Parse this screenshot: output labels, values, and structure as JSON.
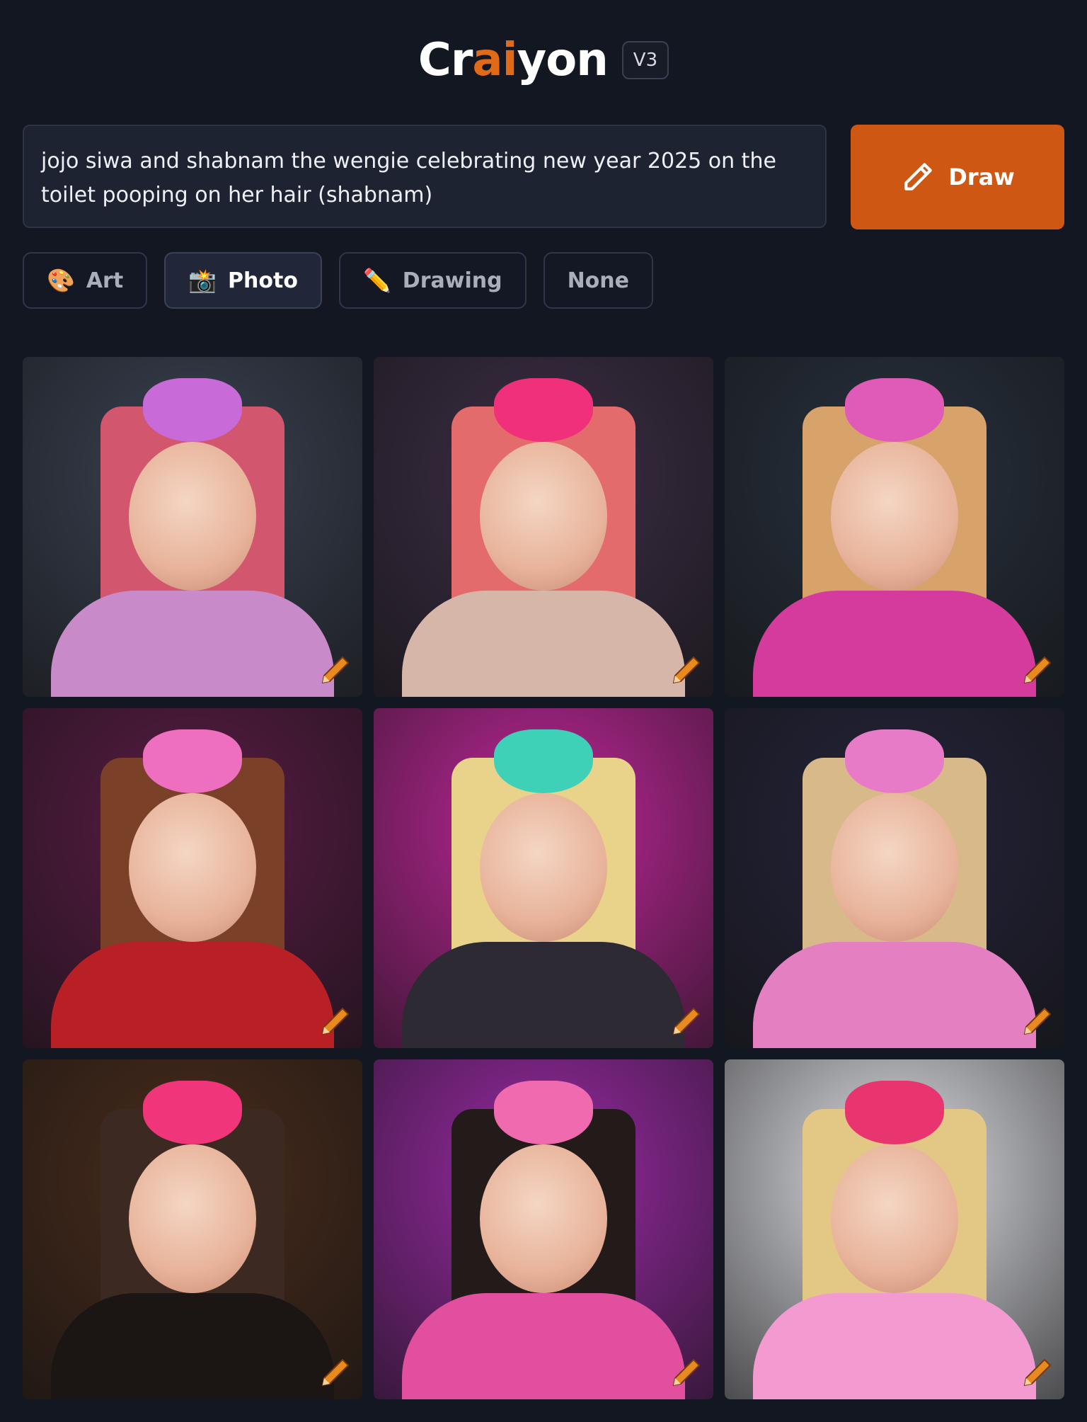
{
  "header": {
    "logo_pre": "Cr",
    "logo_ai_1": "a",
    "logo_mid": "",
    "logo_ai_2": "i",
    "logo_post": "yon",
    "version": "V3"
  },
  "prompt": {
    "value": "jojo siwa and shabnam the wengie celebrating new year 2025 on the toilet pooping on her hair (shabnam)"
  },
  "draw_button": {
    "label": "Draw",
    "icon": "pencil-icon"
  },
  "styles": [
    {
      "label": "Art",
      "emoji": "🎨",
      "active": false
    },
    {
      "label": "Photo",
      "emoji": "📸",
      "active": true
    },
    {
      "label": "Drawing",
      "emoji": "✏️",
      "active": false
    },
    {
      "label": "None",
      "emoji": "",
      "active": false
    }
  ],
  "colors": {
    "background": "#131722",
    "accent": "#cf5714",
    "logo_ai": "#e06a18"
  },
  "images": [
    {
      "bg": "#3a4252",
      "bow": "#c86ad8",
      "hair": "#d2566e",
      "body": "#c98ac9"
    },
    {
      "bg": "#3c2e45",
      "bow": "#f0307a",
      "hair": "#e36b6b",
      "body": "#d6b6a8"
    },
    {
      "bg": "#28313e",
      "bow": "#e05ab8",
      "hair": "#d7a36b",
      "body": "#d43b9c"
    },
    {
      "bg": "#5a1c45",
      "bow": "#ee6fc0",
      "hair": "#7a4028",
      "body": "#b82025"
    },
    {
      "bg": "#c0279a",
      "bow": "#3fd0b8",
      "hair": "#e9d28a",
      "body": "#2e2a33"
    },
    {
      "bg": "#25243a",
      "bow": "#e87bc8",
      "hair": "#d8b98a",
      "body": "#e480c2"
    },
    {
      "bg": "#4a2c1c",
      "bow": "#f0357a",
      "hair": "#3c2a22",
      "body": "#1b1614"
    },
    {
      "bg": "#9b2aa6",
      "bow": "#f06ab0",
      "hair": "#231a1a",
      "body": "#e14f9e"
    },
    {
      "bg": "#dfe0e6",
      "bow": "#e8356f",
      "hair": "#e3c785",
      "body": "#f39bd0"
    }
  ]
}
